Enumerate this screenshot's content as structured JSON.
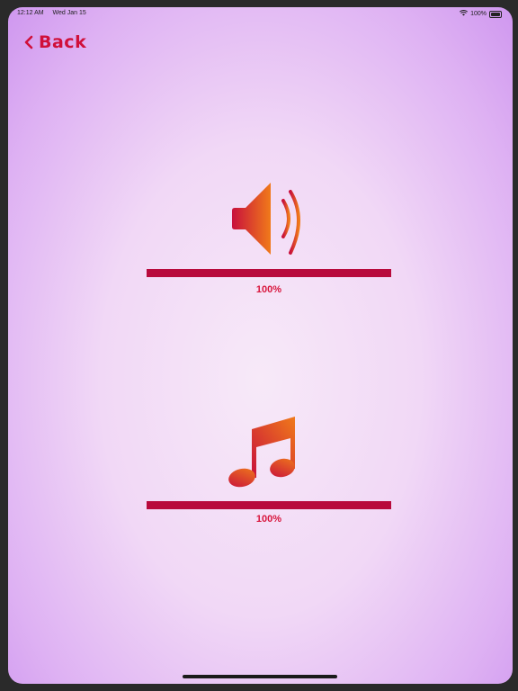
{
  "status_bar": {
    "time": "12:12 AM",
    "date": "Wed Jan 15",
    "battery": "100%"
  },
  "nav": {
    "back_label": "Back"
  },
  "volume": {
    "icon": "speaker-icon",
    "level_percent": 100,
    "level_label": "100%"
  },
  "music": {
    "icon": "music-note-icon",
    "level_percent": 100,
    "level_label": "100%"
  },
  "colors": {
    "accent": "#b80a3c",
    "label": "#d8163d",
    "gradient_start": "#c8103c",
    "gradient_end": "#f07a1a"
  }
}
